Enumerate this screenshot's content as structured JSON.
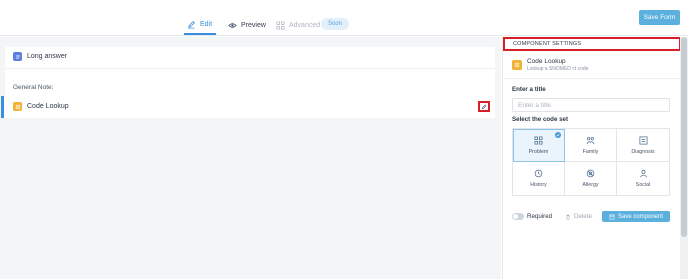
{
  "header": {
    "tabs": [
      {
        "label": "Edit",
        "icon": "pencil-icon",
        "active": true
      },
      {
        "label": "Preview",
        "icon": "eye-icon",
        "active": false
      },
      {
        "label": "Advanced",
        "icon": "grid-icon",
        "active": false,
        "badge": "Soon"
      }
    ],
    "save_form_label": "Save Form"
  },
  "canvas": {
    "long_answer": {
      "title": "Long answer",
      "note_label": "General Note:"
    },
    "code_lookup": {
      "title": "Code Lookup"
    }
  },
  "panel": {
    "title": "COMPONENT SETTINGS",
    "component_name": "Code Lookup",
    "component_desc": "Lookup a SNOMED ct code",
    "enter_title_label": "Enter a title",
    "title_placeholder": "Enter a title",
    "code_set_label": "Select the code set",
    "code_sets": [
      {
        "label": "Problem",
        "icon": "grid-icon",
        "selected": true
      },
      {
        "label": "Family",
        "icon": "family-icon",
        "selected": false
      },
      {
        "label": "Diagnosis",
        "icon": "chart-icon",
        "selected": false
      },
      {
        "label": "History",
        "icon": "clock-icon",
        "selected": false
      },
      {
        "label": "Allergy",
        "icon": "allergy-icon",
        "selected": false
      },
      {
        "label": "Social",
        "icon": "social-icon",
        "selected": false
      }
    ],
    "required_label": "Required",
    "delete_label": "Delete",
    "save_component_label": "Save component"
  },
  "colors": {
    "accent": "#5bb0de",
    "highlight": "#d91f26"
  }
}
